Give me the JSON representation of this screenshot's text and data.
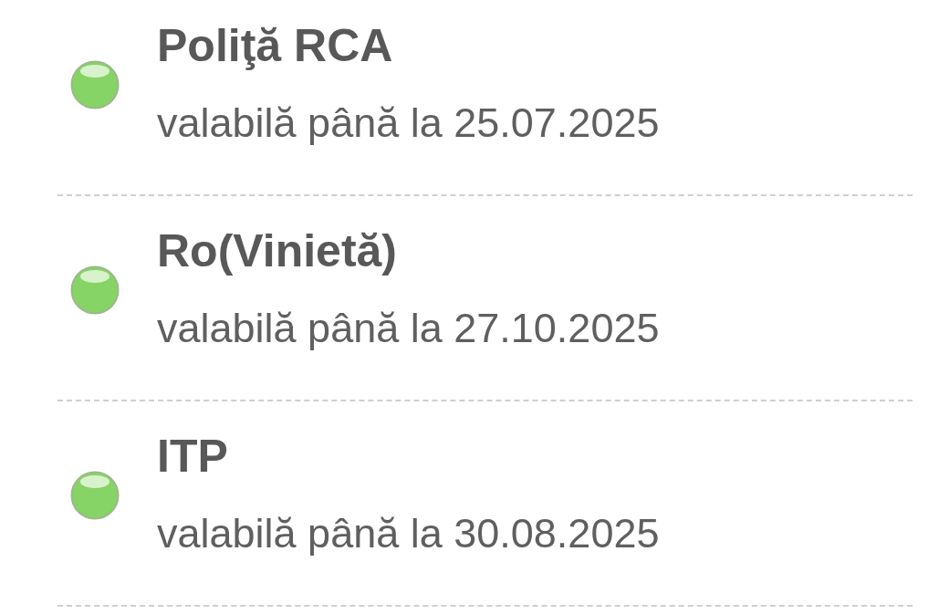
{
  "items": [
    {
      "title": "Poliţă RCA",
      "status": "valabilă până la 25.07.2025",
      "color": "#86d465"
    },
    {
      "title": "Ro(Vinietă)",
      "status": "valabilă până la 27.10.2025",
      "color": "#86d465"
    },
    {
      "title": "ITP",
      "status": "valabilă până la 30.08.2025",
      "color": "#86d465"
    }
  ]
}
